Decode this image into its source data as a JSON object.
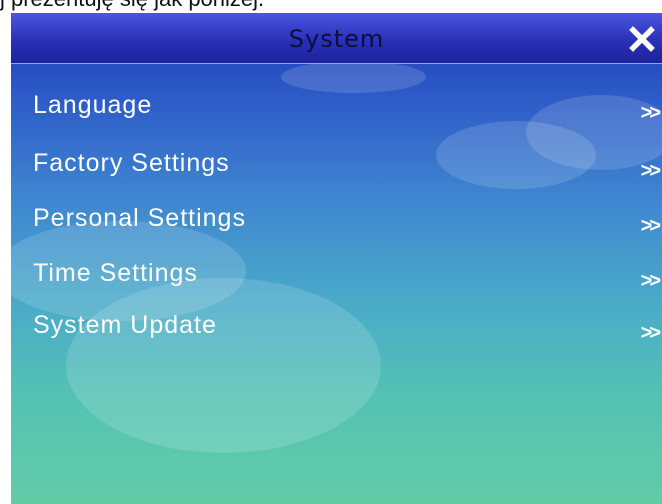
{
  "caption": "j prezentuję się jak poniżej.",
  "window": {
    "title": "System",
    "close_icon": "close-x-icon"
  },
  "menu": {
    "items": [
      {
        "label": "Language",
        "chevron": ">>"
      },
      {
        "label": "Factory Settings",
        "chevron": ">>"
      },
      {
        "label": "Personal Settings",
        "chevron": ">>"
      },
      {
        "label": "Time Settings",
        "chevron": ">>"
      },
      {
        "label": "System Update",
        "chevron": ">>"
      }
    ]
  },
  "colors": {
    "title_bar": "#2a30b8",
    "background_top": "#1a3ab8",
    "background_bottom": "#62cca6",
    "text": "#ffffff"
  }
}
